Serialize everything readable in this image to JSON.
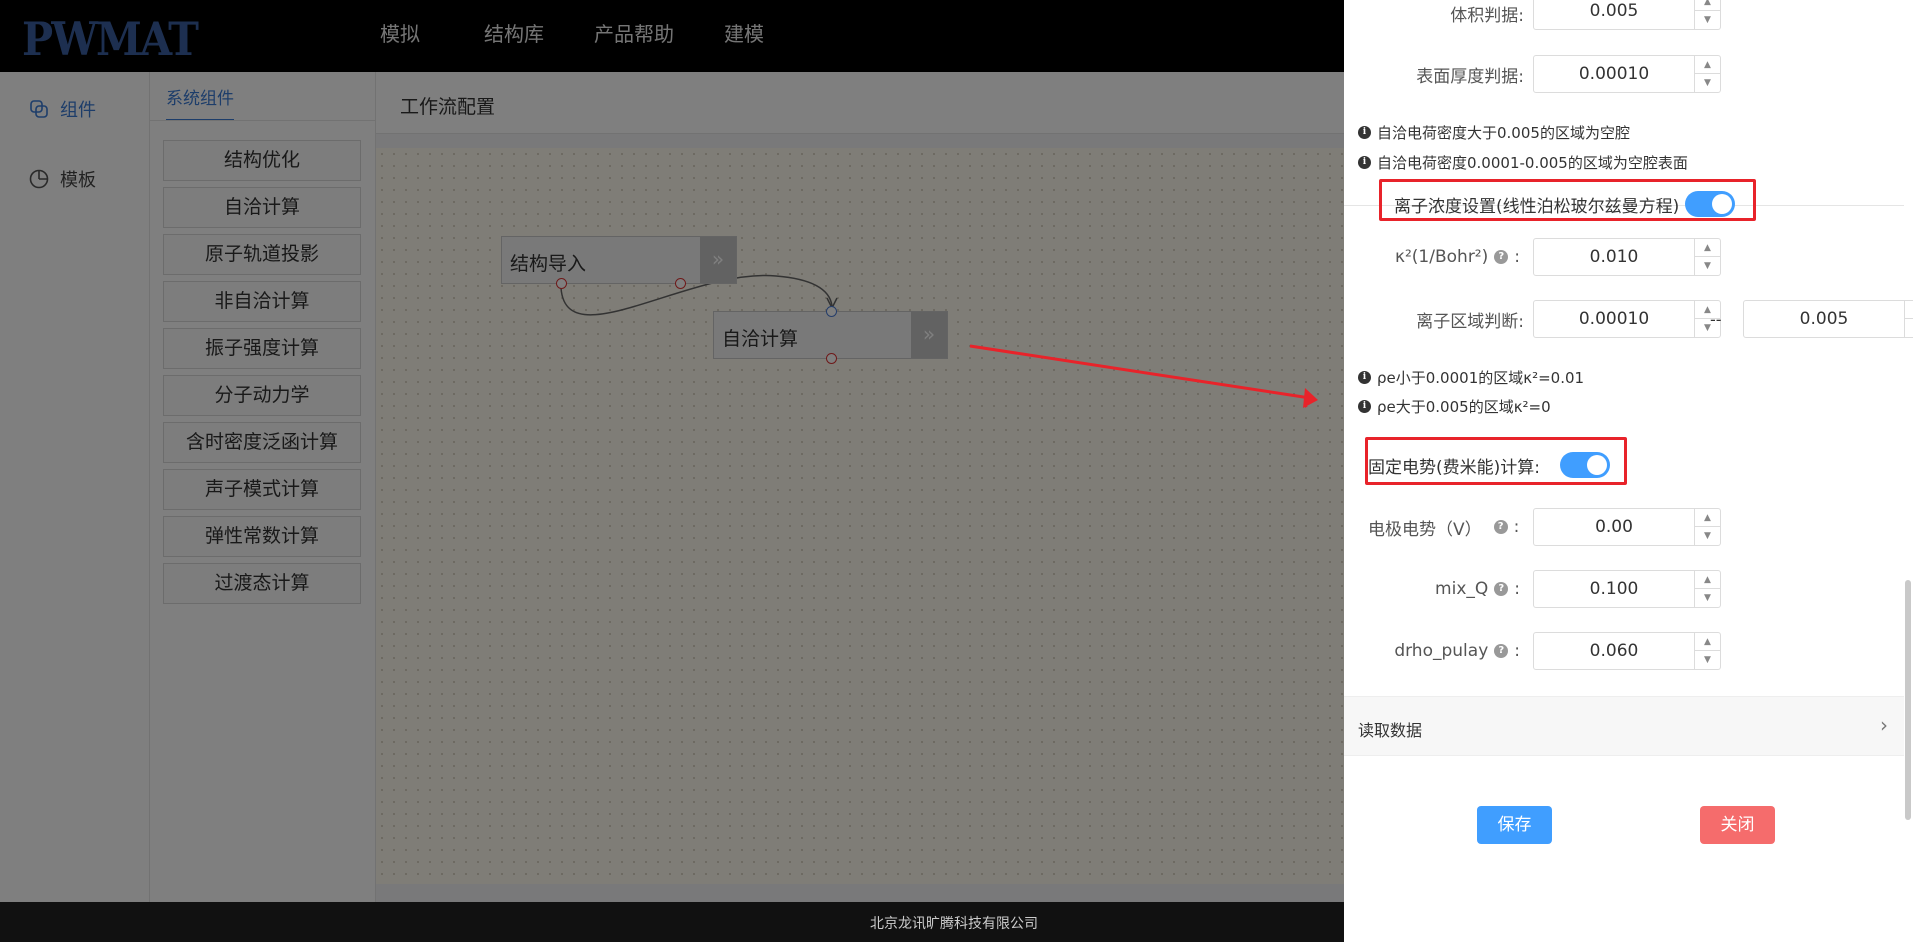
{
  "app": {
    "logo": "PWMAT",
    "nav": [
      "模拟",
      "结构库",
      "产品帮助",
      "建模"
    ]
  },
  "sidebar": {
    "items": [
      {
        "label": "组件",
        "icon": "component-icon"
      },
      {
        "label": "模板",
        "icon": "template-icon"
      }
    ]
  },
  "components": {
    "tab": "系统组件",
    "items": [
      "结构优化",
      "自洽计算",
      "原子轨道投影",
      "非自洽计算",
      "振子强度计算",
      "分子动力学",
      "含时密度泛函计算",
      "声子模式计算",
      "弹性常数计算",
      "过渡态计算"
    ]
  },
  "workflow": {
    "title": "工作流配置",
    "nodes": [
      {
        "label": "结构导入"
      },
      {
        "label": "自洽计算"
      }
    ],
    "node_arrow": "»"
  },
  "drawer": {
    "volume": {
      "label": "体积判据:",
      "value": "0.005"
    },
    "surface": {
      "label": "表面厚度判据:",
      "value": "0.00010"
    },
    "info1": "自洽电荷密度大于0.005的区域为空腔",
    "info2": "自洽电荷密度0.0001-0.005的区域为空腔表面",
    "ion_toggle_label": "离子浓度设置(线性泊松玻尔兹曼方程)",
    "kappa": {
      "label": "κ²(1/Bohr²)",
      "value": "0.010"
    },
    "ion_region": {
      "label": "离子区域判断:",
      "min": "0.00010",
      "sep": "--",
      "max": "0.005"
    },
    "info3": "ρe小于0.0001的区域κ²=0.01",
    "info4": "ρe大于0.005的区域κ²=0",
    "fixed_potential_label": "固定电势(费米能)计算:",
    "electrode": {
      "label": "电极电势（V）",
      "value": "0.00"
    },
    "mixq": {
      "label": "mix_Q",
      "value": "0.100"
    },
    "drho": {
      "label": "drho_pulay",
      "value": "0.060"
    },
    "read_data": "读取数据",
    "save": "保存",
    "close": "关闭",
    "colon": ":",
    "help_glyph": "?",
    "info_glyph": "i",
    "chevron": "›",
    "step_up": "▲",
    "step_down": "▼"
  },
  "footer": "北京龙讯旷腾科技有限公司",
  "colors": {
    "accent": "#409eff",
    "danger": "#f56c6c",
    "highlight": "#e8232a"
  }
}
